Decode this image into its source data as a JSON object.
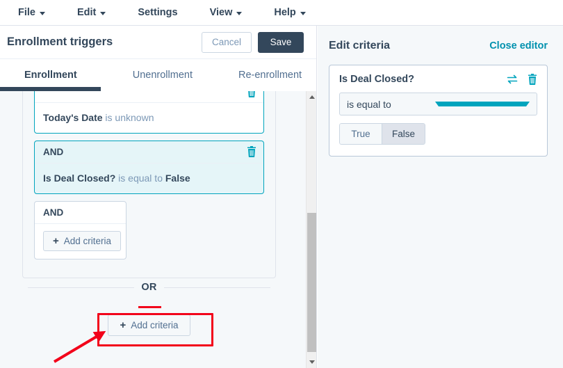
{
  "menubar": {
    "items": [
      {
        "label": "File",
        "has_caret": true,
        "icon": "chevron-down-icon"
      },
      {
        "label": "Edit",
        "has_caret": true,
        "icon": "chevron-down-icon"
      },
      {
        "label": "Settings",
        "has_caret": false,
        "icon": ""
      },
      {
        "label": "View",
        "has_caret": true,
        "icon": "chevron-down-icon"
      },
      {
        "label": "Help",
        "has_caret": true,
        "icon": "chevron-down-icon"
      }
    ]
  },
  "left_panel": {
    "title": "Enrollment triggers",
    "cancel_label": "Cancel",
    "save_label": "Save",
    "tabs": [
      {
        "label": "Enrollment",
        "active": true
      },
      {
        "label": "Unenrollment",
        "active": false
      },
      {
        "label": "Re-enrollment",
        "active": false
      }
    ],
    "criteria_cards": [
      {
        "connector": "",
        "text_bold": "Today's Date",
        "text_rest": " is unknown",
        "selected": false,
        "partial_top": true,
        "delete_icon": "trash-icon"
      },
      {
        "connector": "AND",
        "text_bold": "Is Deal Closed?",
        "text_mid": " is equal to ",
        "text_bold2": "False",
        "selected": true,
        "delete_icon": "trash-icon"
      }
    ],
    "inner_and_card": {
      "connector": "AND",
      "add_criteria_label": "Add criteria",
      "plus_icon": "plus-icon"
    },
    "or_divider_label": "OR",
    "outer_add_criteria_label": "Add criteria",
    "outer_plus_icon": "plus-icon",
    "scrollbar": {
      "up_arrow_icon": "triangle-up-icon",
      "down_arrow_icon": "triangle-down-icon"
    }
  },
  "right_panel": {
    "title": "Edit criteria",
    "close_label": "Close editor",
    "editor": {
      "property_name": "Is Deal Closed?",
      "swap_icon": "swap-arrows-icon",
      "delete_icon": "trash-icon",
      "operator_value": "is equal to",
      "operator_caret_icon": "caret-down-icon",
      "value_options": [
        {
          "label": "True",
          "selected": false
        },
        {
          "label": "False",
          "selected": true
        }
      ]
    }
  },
  "annotations": {
    "highlight_color": "#f2021a",
    "arrow_icon": "arrow-up-right-icon",
    "rect_icon": "highlight-rectangle",
    "underline_icon": "underline-mark"
  }
}
